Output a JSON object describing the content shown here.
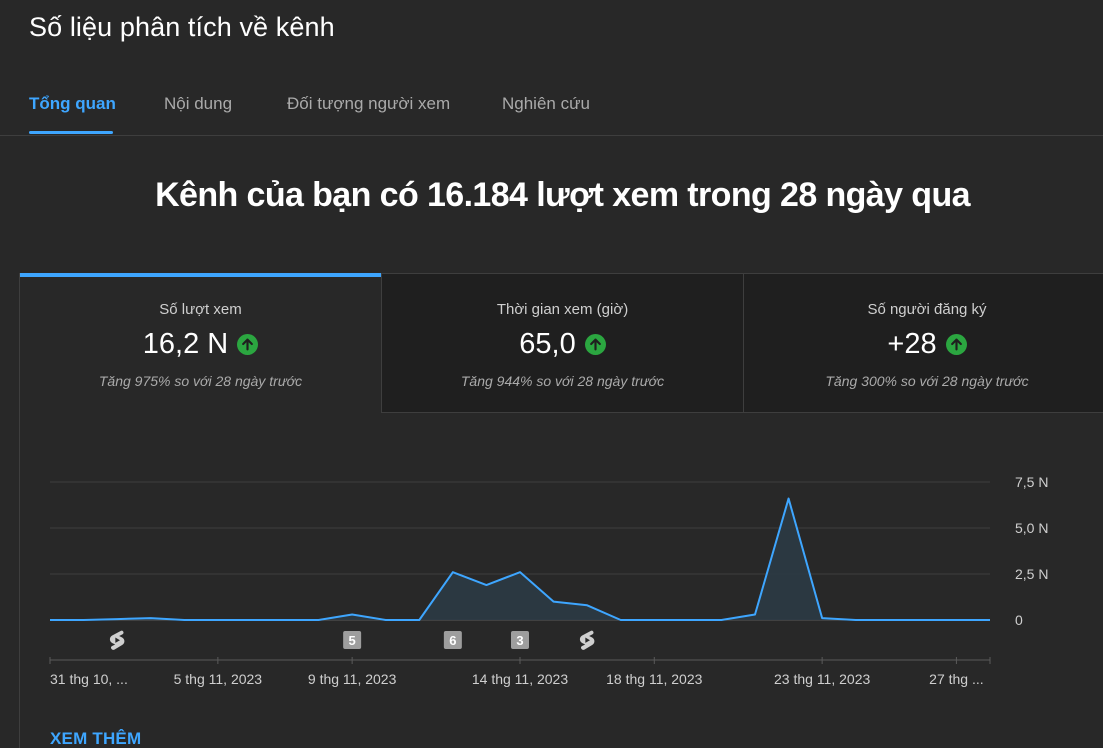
{
  "page": {
    "title": "Số liệu phân tích về kênh"
  },
  "tabs": [
    {
      "label": "Tổng quan",
      "active": true
    },
    {
      "label": "Nội dung",
      "active": false
    },
    {
      "label": "Đối tượng người xem",
      "active": false
    },
    {
      "label": "Nghiên cứu",
      "active": false
    }
  ],
  "headline": "Kênh của bạn có 16.184 lượt xem trong 28 ngày qua",
  "metrics": [
    {
      "label": "Số lượt xem",
      "value": "16,2 N",
      "change": "Tăng 975% so với 28 ngày trước",
      "icon": "arrow-up-icon",
      "active": true
    },
    {
      "label": "Thời gian xem (giờ)",
      "value": "65,0",
      "change": "Tăng 944% so với 28 ngày trước",
      "icon": "arrow-up-icon",
      "active": false
    },
    {
      "label": "Số người đăng ký",
      "value": "+28",
      "change": "Tăng 300% so với 28 ngày trước",
      "icon": "arrow-up-icon",
      "active": false
    }
  ],
  "colors": {
    "accent": "#3ea6ff",
    "up": "#2ba640",
    "line": "#3ea6ff",
    "background": "#282828"
  },
  "chart_data": {
    "type": "area",
    "x": [
      "31/10",
      "1/11",
      "2/11",
      "3/11",
      "4/11",
      "5/11",
      "6/11",
      "7/11",
      "8/11",
      "9/11",
      "10/11",
      "11/11",
      "12/11",
      "13/11",
      "14/11",
      "15/11",
      "16/11",
      "17/11",
      "18/11",
      "19/11",
      "20/11",
      "21/11",
      "22/11",
      "23/11",
      "24/11",
      "25/11",
      "26/11",
      "27/11",
      "28/11"
    ],
    "values": [
      0,
      0,
      50,
      100,
      0,
      0,
      0,
      0,
      0,
      300,
      0,
      0,
      2600,
      1900,
      2600,
      1000,
      800,
      0,
      0,
      0,
      0,
      300,
      6600,
      100,
      0,
      0,
      0,
      0,
      0
    ],
    "y_ticks": [
      "0",
      "2,5 N",
      "5,0 N",
      "7,5 N"
    ],
    "y_tick_values": [
      0,
      2500,
      5000,
      7500
    ],
    "ylim": [
      0,
      7500
    ],
    "x_tick_labels": [
      "31 thg 10, ...",
      "5 thg 11, 2023",
      "9 thg 11, 2023",
      "14 thg 11, 2023",
      "18 thg 11, 2023",
      "23 thg 11, 2023",
      "27 thg ..."
    ],
    "x_tick_indices": [
      0,
      5,
      9,
      14,
      18,
      23,
      27
    ],
    "markers": [
      {
        "x_index": 2,
        "kind": "shorts",
        "label": ""
      },
      {
        "x_index": 9,
        "kind": "count",
        "label": "5"
      },
      {
        "x_index": 12,
        "kind": "count",
        "label": "6"
      },
      {
        "x_index": 14,
        "kind": "count",
        "label": "3"
      },
      {
        "x_index": 16,
        "kind": "shorts",
        "label": ""
      }
    ],
    "grid": true
  },
  "see_more": "XEM THÊM"
}
